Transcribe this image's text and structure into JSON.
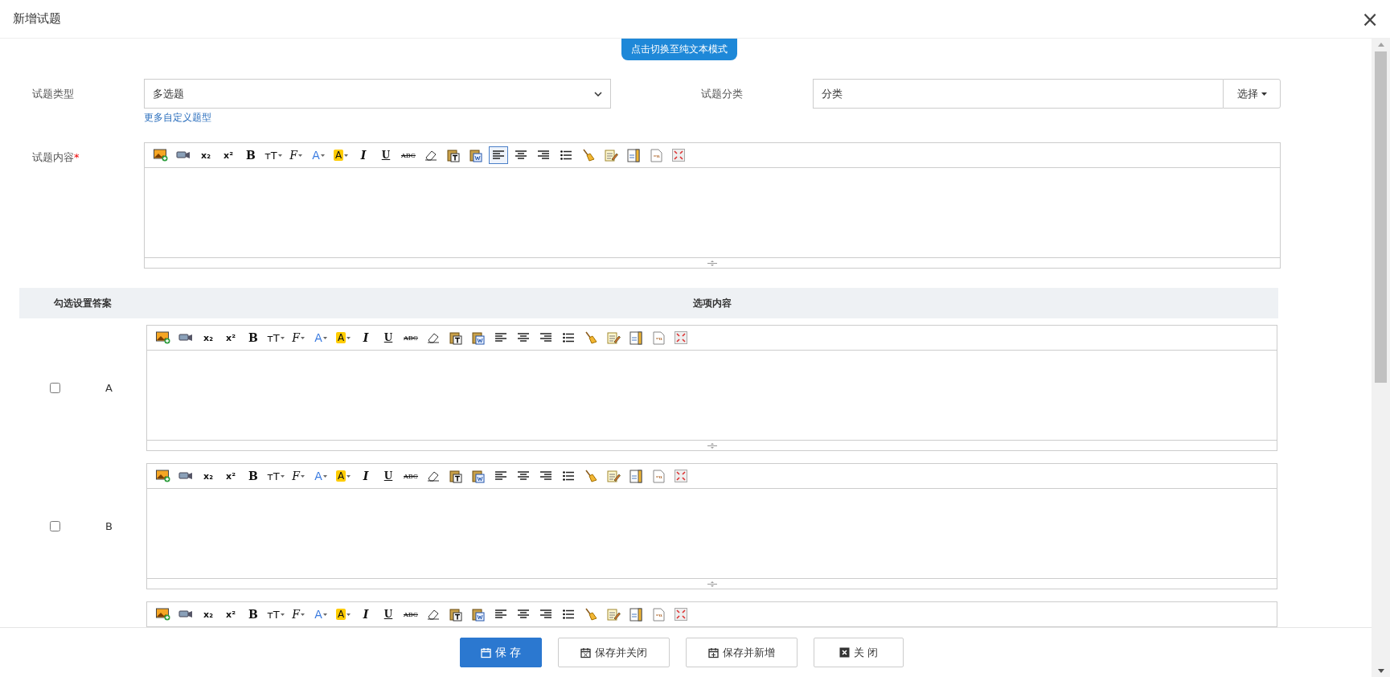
{
  "window": {
    "title": "新增试题",
    "close": "×"
  },
  "mode_toggle": "点击切换至纯文本模式",
  "question_type": {
    "label": "试题类型",
    "value": "多选题",
    "link": "更多自定义题型"
  },
  "category": {
    "label": "试题分类",
    "value": "分类",
    "button": "选择"
  },
  "content": {
    "label": "试题内容",
    "required_mark": "*",
    "editor": {
      "toolbar": [
        {
          "kind": "image",
          "active": false
        },
        {
          "kind": "video",
          "active": false
        },
        {
          "kind": "subscript",
          "glyph": "x₂",
          "active": false
        },
        {
          "kind": "superscript",
          "glyph": "x²",
          "active": false
        },
        {
          "kind": "bold",
          "glyph": "B",
          "active": false
        },
        {
          "kind": "font-size",
          "glyph": "ᴛT",
          "active": false
        },
        {
          "kind": "font-family",
          "glyph": "F",
          "active": false
        },
        {
          "kind": "font-color",
          "glyph": "A",
          "active": false
        },
        {
          "kind": "highlight",
          "glyph": "A",
          "active": false
        },
        {
          "kind": "italic",
          "glyph": "I",
          "active": false
        },
        {
          "kind": "underline",
          "glyph": "U",
          "active": false
        },
        {
          "kind": "strike",
          "glyph": "ABC",
          "active": false
        },
        {
          "kind": "eraser",
          "active": false
        },
        {
          "kind": "paste-text",
          "active": false
        },
        {
          "kind": "paste-word",
          "active": false
        },
        {
          "kind": "align-left",
          "active": true
        },
        {
          "kind": "align-center",
          "active": false
        },
        {
          "kind": "align-right",
          "active": false
        },
        {
          "kind": "list",
          "active": false
        },
        {
          "kind": "brush",
          "active": false
        },
        {
          "kind": "notes",
          "active": false
        },
        {
          "kind": "document",
          "active": false
        },
        {
          "kind": "code",
          "active": false
        },
        {
          "kind": "fullscreen",
          "active": false
        }
      ]
    }
  },
  "options_table": {
    "columns": [
      "勾选设置答案",
      "选项内容"
    ],
    "rows": [
      {
        "letter": "A",
        "checked": false,
        "editor": {
          "toolbar": [
            {
              "kind": "image",
              "active": false
            },
            {
              "kind": "video",
              "active": false
            },
            {
              "kind": "subscript",
              "glyph": "x₂",
              "active": false
            },
            {
              "kind": "superscript",
              "glyph": "x²",
              "active": false
            },
            {
              "kind": "bold",
              "glyph": "B",
              "active": false
            },
            {
              "kind": "font-size",
              "glyph": "ᴛT",
              "active": false
            },
            {
              "kind": "font-family",
              "glyph": "F",
              "active": false
            },
            {
              "kind": "font-color",
              "glyph": "A",
              "active": false
            },
            {
              "kind": "highlight",
              "glyph": "A",
              "active": false
            },
            {
              "kind": "italic",
              "glyph": "I",
              "active": false
            },
            {
              "kind": "underline",
              "glyph": "U",
              "active": false
            },
            {
              "kind": "strike",
              "glyph": "ABC",
              "active": false
            },
            {
              "kind": "eraser",
              "active": false
            },
            {
              "kind": "paste-text",
              "active": false
            },
            {
              "kind": "paste-word",
              "active": false
            },
            {
              "kind": "align-left",
              "active": false
            },
            {
              "kind": "align-center",
              "active": false
            },
            {
              "kind": "align-right",
              "active": false
            },
            {
              "kind": "list",
              "active": false
            },
            {
              "kind": "brush",
              "active": false
            },
            {
              "kind": "notes",
              "active": false
            },
            {
              "kind": "document",
              "active": false
            },
            {
              "kind": "code",
              "active": false
            },
            {
              "kind": "fullscreen",
              "active": false
            }
          ]
        }
      },
      {
        "letter": "B",
        "checked": false,
        "editor": {
          "toolbar": [
            {
              "kind": "image",
              "active": false
            },
            {
              "kind": "video",
              "active": false
            },
            {
              "kind": "subscript",
              "glyph": "x₂",
              "active": false
            },
            {
              "kind": "superscript",
              "glyph": "x²",
              "active": false
            },
            {
              "kind": "bold",
              "glyph": "B",
              "active": false
            },
            {
              "kind": "font-size",
              "glyph": "ᴛT",
              "active": false
            },
            {
              "kind": "font-family",
              "glyph": "F",
              "active": false
            },
            {
              "kind": "font-color",
              "glyph": "A",
              "active": false
            },
            {
              "kind": "highlight",
              "glyph": "A",
              "active": false
            },
            {
              "kind": "italic",
              "glyph": "I",
              "active": false
            },
            {
              "kind": "underline",
              "glyph": "U",
              "active": false
            },
            {
              "kind": "strike",
              "glyph": "ABC",
              "active": false
            },
            {
              "kind": "eraser",
              "active": false
            },
            {
              "kind": "paste-text",
              "active": false
            },
            {
              "kind": "paste-word",
              "active": false
            },
            {
              "kind": "align-left",
              "active": false
            },
            {
              "kind": "align-center",
              "active": false
            },
            {
              "kind": "align-right",
              "active": false
            },
            {
              "kind": "list",
              "active": false
            },
            {
              "kind": "brush",
              "active": false
            },
            {
              "kind": "notes",
              "active": false
            },
            {
              "kind": "document",
              "active": false
            },
            {
              "kind": "code",
              "active": false
            },
            {
              "kind": "fullscreen",
              "active": false
            }
          ]
        }
      },
      {
        "editor": {
          "toolbar": [
            {
              "kind": "image",
              "active": false
            },
            {
              "kind": "video",
              "active": false
            },
            {
              "kind": "subscript",
              "glyph": "x₂",
              "active": false
            },
            {
              "kind": "superscript",
              "glyph": "x²",
              "active": false
            },
            {
              "kind": "bold",
              "glyph": "B",
              "active": false
            },
            {
              "kind": "font-size",
              "glyph": "ᴛT",
              "active": false
            },
            {
              "kind": "font-family",
              "glyph": "F",
              "active": false
            },
            {
              "kind": "font-color",
              "glyph": "A",
              "active": false
            },
            {
              "kind": "highlight",
              "glyph": "A",
              "active": false
            },
            {
              "kind": "italic",
              "glyph": "I",
              "active": false
            },
            {
              "kind": "underline",
              "glyph": "U",
              "active": false
            },
            {
              "kind": "strike",
              "glyph": "ABC",
              "active": false
            },
            {
              "kind": "eraser",
              "active": false
            },
            {
              "kind": "paste-text",
              "active": false
            },
            {
              "kind": "paste-word",
              "active": false
            },
            {
              "kind": "align-left",
              "active": false
            },
            {
              "kind": "align-center",
              "active": false
            },
            {
              "kind": "align-right",
              "active": false
            },
            {
              "kind": "list",
              "active": false
            },
            {
              "kind": "brush",
              "active": false
            },
            {
              "kind": "notes",
              "active": false
            },
            {
              "kind": "document",
              "active": false
            },
            {
              "kind": "code",
              "active": false
            },
            {
              "kind": "fullscreen",
              "active": false
            }
          ]
        }
      }
    ]
  },
  "footer_buttons": [
    {
      "kind": "save",
      "label": "保 存"
    },
    {
      "kind": "save-close",
      "label": "保存并关闭"
    },
    {
      "kind": "save-new",
      "label": "保存并新增"
    },
    {
      "kind": "close",
      "label": "关 闭"
    }
  ]
}
